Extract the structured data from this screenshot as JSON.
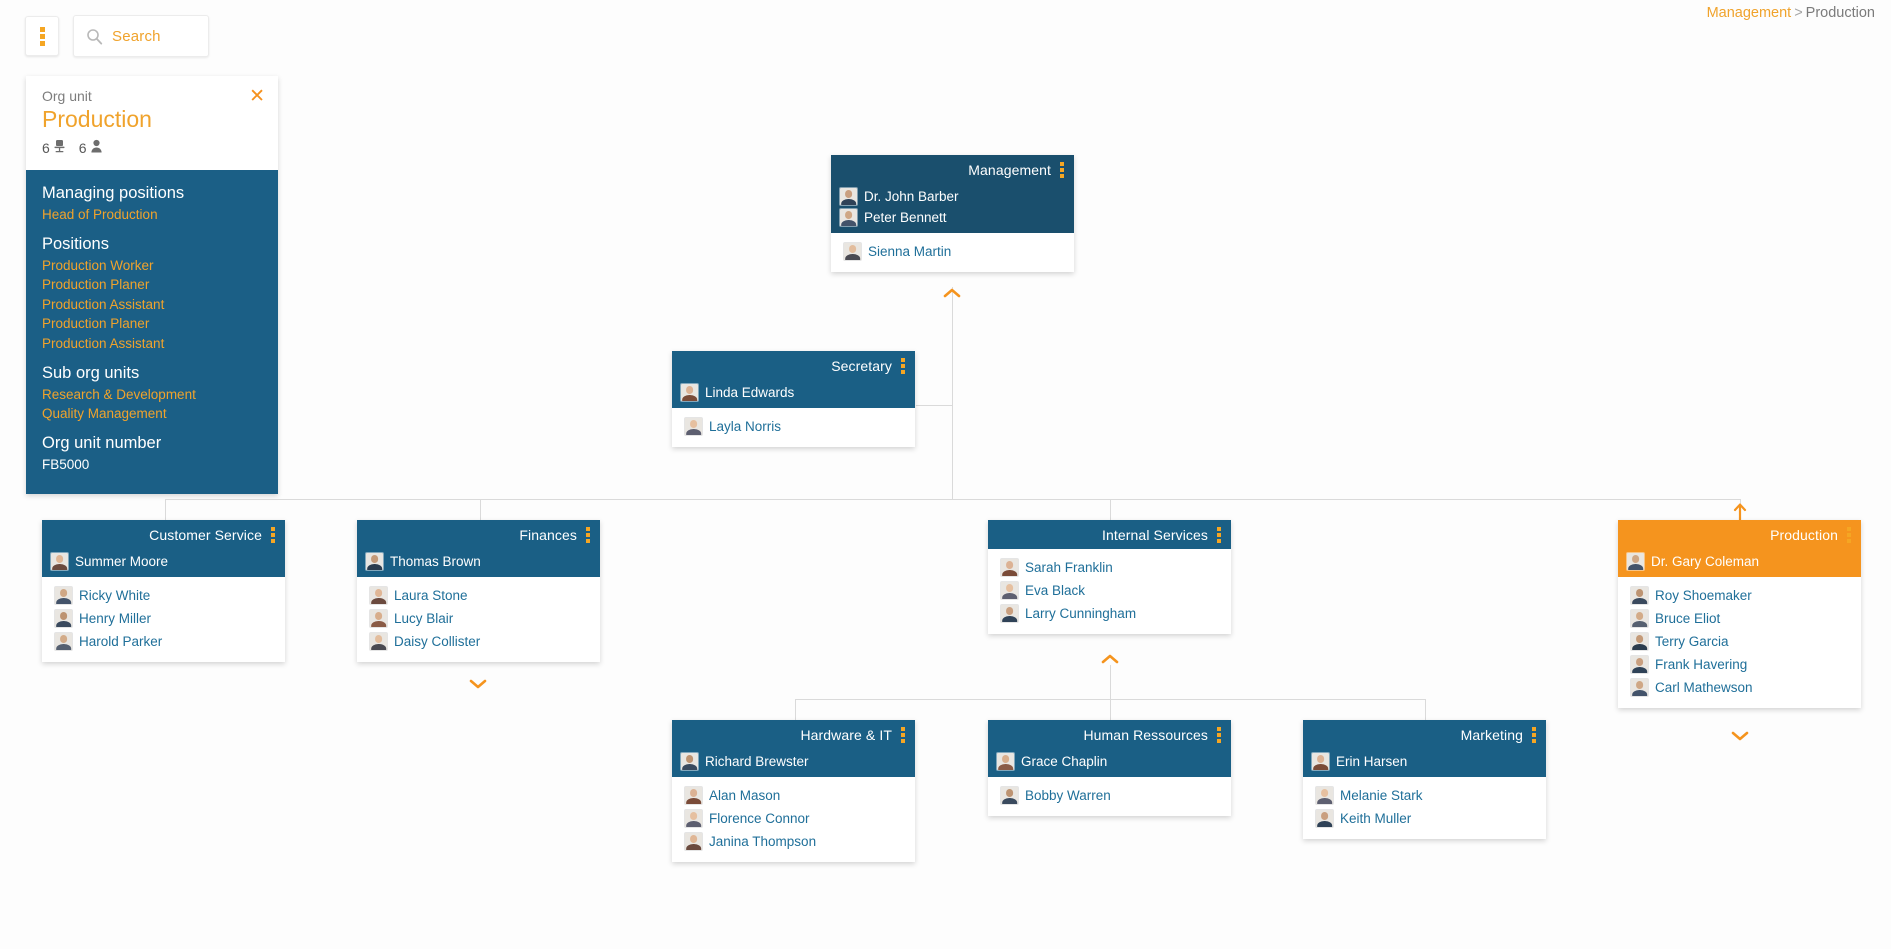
{
  "toolbar": {
    "menu_icon": "kebab-menu-icon",
    "search_icon": "search-icon",
    "search_placeholder": "Search",
    "search_value": ""
  },
  "breadcrumb": {
    "root": "Management",
    "separator": ">",
    "current": "Production"
  },
  "info_panel": {
    "kicker": "Org unit",
    "title": "Production",
    "close_icon": "close-icon",
    "position_count": "6",
    "position_icon": "chair-icon",
    "people_count": "6",
    "people_icon": "person-icon",
    "sections": [
      {
        "heading": "Managing positions",
        "items": [
          "Head of Production"
        ],
        "style": "link"
      },
      {
        "heading": "Positions",
        "items": [
          "Production Worker",
          "Production Planer",
          "Production Assistant",
          "Production Planer",
          "Production Assistant"
        ],
        "style": "link"
      },
      {
        "heading": "Sub org units",
        "items": [
          "Research & Development",
          "Quality Management"
        ],
        "style": "link"
      },
      {
        "heading": "Org unit number",
        "items": [
          "FB5000"
        ],
        "style": "plain"
      }
    ]
  },
  "colors": {
    "accent_orange": "#f5941e",
    "node_header_blue": "#1a5f85",
    "node_dark_blue": "#1a4f6d",
    "info_panel_blue": "#1b5f86",
    "link_blue": "#1f6f99",
    "line_gray": "#dadada"
  },
  "nodes": [
    {
      "id": "management",
      "title": "Management",
      "variant": "dark",
      "menu_icon": "kebab-menu-icon",
      "managers": [
        {
          "name": "Dr. John Barber",
          "avatar": "photo-male"
        },
        {
          "name": "Peter Bennett",
          "avatar": "photo-male"
        }
      ],
      "staff": [
        {
          "name": "Sienna Martin",
          "avatar": "photo-female"
        }
      ]
    },
    {
      "id": "secretary",
      "title": "Secretary",
      "variant": "normal",
      "menu_icon": "kebab-menu-icon",
      "managers": [
        {
          "name": "Linda Edwards",
          "avatar": "photo-female"
        }
      ],
      "staff": [
        {
          "name": "Layla Norris",
          "avatar": "photo-female"
        }
      ]
    },
    {
      "id": "customer-service",
      "title": "Customer Service",
      "variant": "normal",
      "menu_icon": "kebab-menu-icon",
      "managers": [
        {
          "name": "Summer Moore",
          "avatar": "photo-female"
        }
      ],
      "staff": [
        {
          "name": "Ricky White",
          "avatar": "photo-male"
        },
        {
          "name": "Henry Miller",
          "avatar": "photo-male"
        },
        {
          "name": "Harold Parker",
          "avatar": "photo-male"
        }
      ]
    },
    {
      "id": "finances",
      "title": "Finances",
      "variant": "normal",
      "menu_icon": "kebab-menu-icon",
      "managers": [
        {
          "name": "Thomas Brown",
          "avatar": "photo-male"
        }
      ],
      "staff": [
        {
          "name": "Laura Stone",
          "avatar": "photo-female"
        },
        {
          "name": "Lucy Blair",
          "avatar": "photo-female"
        },
        {
          "name": "Daisy Collister",
          "avatar": "photo-female"
        }
      ]
    },
    {
      "id": "internal-services",
      "title": "Internal Services",
      "variant": "normal",
      "menu_icon": "kebab-menu-icon",
      "managers": [],
      "staff": [
        {
          "name": "Sarah Franklin",
          "avatar": "photo-female"
        },
        {
          "name": "Eva Black",
          "avatar": "photo-female"
        },
        {
          "name": "Larry Cunningham",
          "avatar": "photo-male"
        }
      ]
    },
    {
      "id": "production",
      "title": "Production",
      "variant": "accent",
      "menu_icon": "kebab-menu-icon",
      "managers": [
        {
          "name": "Dr. Gary Coleman",
          "avatar": "photo-male"
        }
      ],
      "staff": [
        {
          "name": "Roy Shoemaker",
          "avatar": "photo-male"
        },
        {
          "name": "Bruce Eliot",
          "avatar": "photo-male"
        },
        {
          "name": "Terry Garcia",
          "avatar": "photo-male"
        },
        {
          "name": "Frank Havering",
          "avatar": "photo-male"
        },
        {
          "name": "Carl Mathewson",
          "avatar": "photo-male"
        }
      ]
    },
    {
      "id": "hardware-it",
      "title": "Hardware & IT",
      "variant": "normal",
      "menu_icon": "kebab-menu-icon",
      "managers": [
        {
          "name": "Richard Brewster",
          "avatar": "photo-male"
        }
      ],
      "staff": [
        {
          "name": "Alan Mason",
          "avatar": "photo-female"
        },
        {
          "name": "Florence Connor",
          "avatar": "photo-female"
        },
        {
          "name": "Janina Thompson",
          "avatar": "photo-female"
        }
      ]
    },
    {
      "id": "human-ressources",
      "title": "Human Ressources",
      "variant": "normal",
      "menu_icon": "kebab-menu-icon",
      "managers": [
        {
          "name": "Grace Chaplin",
          "avatar": "photo-female"
        }
      ],
      "staff": [
        {
          "name": "Bobby Warren",
          "avatar": "photo-male"
        }
      ]
    },
    {
      "id": "marketing",
      "title": "Marketing",
      "variant": "normal",
      "menu_icon": "kebab-menu-icon",
      "managers": [
        {
          "name": "Erin Harsen",
          "avatar": "photo-female"
        }
      ],
      "staff": [
        {
          "name": "Melanie Stark",
          "avatar": "photo-female"
        },
        {
          "name": "Keith Muller",
          "avatar": "photo-male"
        }
      ]
    }
  ],
  "expanders": [
    {
      "id": "expander-management-up",
      "icon": "chevron-up-icon"
    },
    {
      "id": "expander-finances-down",
      "icon": "chevron-down-icon"
    },
    {
      "id": "expander-internal-services-up",
      "icon": "chevron-up-icon"
    },
    {
      "id": "expander-production-up",
      "icon": "arrow-up-icon"
    },
    {
      "id": "expander-production-down",
      "icon": "chevron-down-icon"
    }
  ]
}
